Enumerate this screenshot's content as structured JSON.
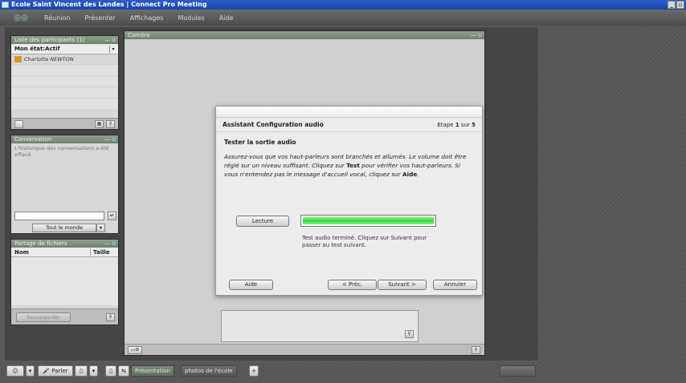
{
  "window": {
    "title": "Ecole Saint Vincent des Landes | Connect Pro Meeting"
  },
  "menu": {
    "items": [
      "Réunion",
      "Présenter",
      "Affichages",
      "Modules",
      "Aide"
    ]
  },
  "participants": {
    "title": "Liste des participants (1)",
    "status": "Mon état:Actif",
    "list": [
      "Charlotte NEWTON"
    ]
  },
  "chat": {
    "title": "Conversation",
    "history": "L'historique des conversations a été effacé.",
    "target": "Tout le monde"
  },
  "files": {
    "title": "Partage de fichiers",
    "col_name": "Nom",
    "col_size": "Taille",
    "save_label": "Sauvegarder"
  },
  "camera": {
    "title": "Caméra"
  },
  "dialog": {
    "title": "Assistant Configuration audio",
    "step_prefix": "Etape",
    "step_current": "1",
    "step_sep": "sur",
    "step_total": "5",
    "subtitle": "Tester la sortie audio",
    "text_part1": "Assurez-vous que vos haut-parleurs sont branchés et allumés. Le volume doit être réglé sur un niveau suffisant.  Cliquez sur ",
    "text_bold1": "Test",
    "text_part2": " pour vérifier vos haut-parleurs. Si vous n'entendez pas le message d'accueil vocal, cliquez sur ",
    "text_bold2": "Aide",
    "text_part3": ".",
    "play_label": "Lecture",
    "meter_level": 1.0,
    "meter_message": "Test audio terminé. Cliquez sur Suivant pour passer au test suivant.",
    "help_label": "Aide",
    "prev_label": "< Préc.",
    "next_label": "Suivant >",
    "cancel_label": "Annuler"
  },
  "toolbar": {
    "talk_label": "Parler",
    "tab_presentation": "Présentation",
    "tab_photos": "photos de l'école",
    "add_label": "+"
  },
  "colors": {
    "titlebar": "#1c46a8",
    "pod_header": "#7a8f78",
    "meter": "#42d342"
  }
}
